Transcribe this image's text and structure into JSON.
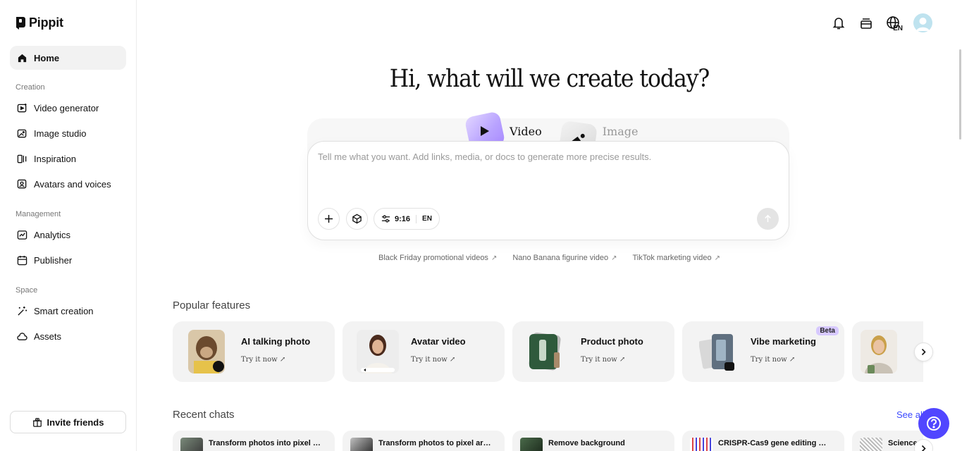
{
  "app": {
    "name": "Pippit"
  },
  "sidebar": {
    "home": "Home",
    "sections": {
      "creation": "Creation",
      "management": "Management",
      "space": "Space"
    },
    "creation_items": [
      "Video generator",
      "Image studio",
      "Inspiration",
      "Avatars and voices"
    ],
    "management_items": [
      "Analytics",
      "Publisher"
    ],
    "space_items": [
      "Smart creation",
      "Assets"
    ],
    "invite": "Invite friends"
  },
  "header": {
    "language": "EN"
  },
  "hero": {
    "title": "Hi, what will we create today?",
    "modes": [
      "Video",
      "Image"
    ],
    "placeholder": "Tell me what you want. Add links, media, or docs to generate more precise results.",
    "aspect_ratio": "9:16",
    "language": "EN"
  },
  "suggestions": [
    "Black Friday promotional videos",
    "Nano Banana figurine video",
    "TikTok marketing video"
  ],
  "popular": {
    "title": "Popular features",
    "cards": [
      {
        "title": "AI talking photo",
        "cta": "Try it now"
      },
      {
        "title": "Avatar video",
        "cta": "Try it now"
      },
      {
        "title": "Product photo",
        "cta": "Try it now"
      },
      {
        "title": "Vibe marketing",
        "cta": "Try it now",
        "badge": "Beta"
      }
    ]
  },
  "recent": {
    "title": "Recent chats",
    "see_all": "See all",
    "chats": [
      "Transform photos into pixel a...",
      "Transform photos to pixel art ...",
      "Remove background",
      "CRISPR-Cas9 gene editing m...",
      "Science"
    ]
  },
  "colors": {
    "accent": "#5146ff",
    "link": "#3b49ff",
    "beta": "#d7c9ff",
    "video_tile": "#b8a2ff"
  }
}
